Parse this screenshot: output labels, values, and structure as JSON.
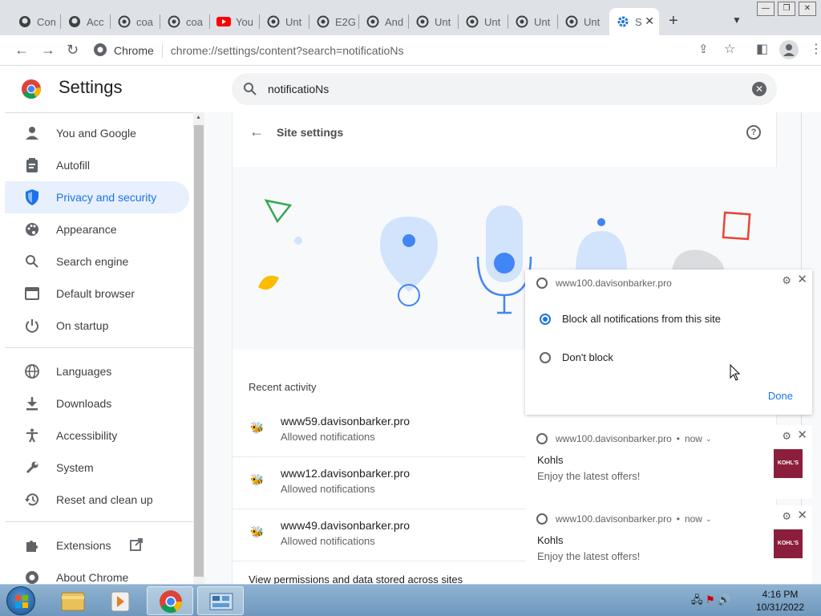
{
  "browser": {
    "tabs": [
      {
        "label": "Con",
        "icon": "github-icon"
      },
      {
        "label": "Acc",
        "icon": "github-icon"
      },
      {
        "label": "coa",
        "icon": "globe-icon"
      },
      {
        "label": "coa",
        "icon": "globe-icon"
      },
      {
        "label": "You",
        "icon": "youtube-icon"
      },
      {
        "label": "Unt",
        "icon": "globe-icon"
      },
      {
        "label": "E2G",
        "icon": "globe-icon"
      },
      {
        "label": "And",
        "icon": "globe-icon"
      },
      {
        "label": "Unt",
        "icon": "globe-icon"
      },
      {
        "label": "Unt",
        "icon": "globe-icon"
      },
      {
        "label": "Unt",
        "icon": "globe-icon"
      },
      {
        "label": "S",
        "icon": "settings-gear-icon"
      }
    ],
    "omnibox": {
      "site_label": "Chrome",
      "url": "chrome://settings/content?search=notificatioNs"
    }
  },
  "settings": {
    "title": "Settings",
    "search_value": "notificatioNs",
    "nav": [
      {
        "label": "You and Google",
        "icon": "person-icon"
      },
      {
        "label": "Autofill",
        "icon": "clipboard-icon"
      },
      {
        "label": "Privacy and security",
        "icon": "shield-icon"
      },
      {
        "label": "Appearance",
        "icon": "palette-icon"
      },
      {
        "label": "Search engine",
        "icon": "search-icon"
      },
      {
        "label": "Default browser",
        "icon": "browser-window-icon"
      },
      {
        "label": "On startup",
        "icon": "power-icon"
      },
      {
        "label": "Languages",
        "icon": "globe-icon"
      },
      {
        "label": "Downloads",
        "icon": "download-icon"
      },
      {
        "label": "Accessibility",
        "icon": "accessibility-icon"
      },
      {
        "label": "System",
        "icon": "wrench-icon"
      },
      {
        "label": "Reset and clean up",
        "icon": "history-icon"
      },
      {
        "label": "Extensions",
        "icon": "puzzle-icon"
      },
      {
        "label": "About Chrome",
        "icon": "chrome-icon"
      }
    ],
    "active_nav": "Privacy and security",
    "page": {
      "title": "Site settings",
      "recent_activity_title": "Recent activity",
      "recent": [
        {
          "site": "www59.davisonbarker.pro",
          "status": "Allowed notifications"
        },
        {
          "site": "www12.davisonbarker.pro",
          "status": "Allowed notifications"
        },
        {
          "site": "www49.davisonbarker.pro",
          "status": "Allowed notifications"
        }
      ],
      "view_permissions": "View permissions and data stored across sites"
    }
  },
  "notifications": {
    "permission_popup": {
      "origin": "www100.davisonbarker.pro",
      "option_block": "Block all notifications from this site",
      "option_allow": "Don't block",
      "selected": "block",
      "done_label": "Done"
    },
    "items": [
      {
        "origin": "www100.davisonbarker.pro",
        "time": "now",
        "title": "Kohls",
        "body": "Enjoy the latest offers!",
        "image_text": "KOHL'S"
      },
      {
        "origin": "www100.davisonbarker.pro",
        "time": "now",
        "title": "Kohls",
        "body": "Enjoy the latest offers!",
        "image_text": "KOHL'S"
      }
    ]
  },
  "taskbar": {
    "time": "4:16 PM",
    "date": "10/31/2022"
  },
  "colors": {
    "accent": "#1a73e8",
    "active_nav_bg": "#e8f0fe",
    "kohls": "#8b1f3b"
  }
}
